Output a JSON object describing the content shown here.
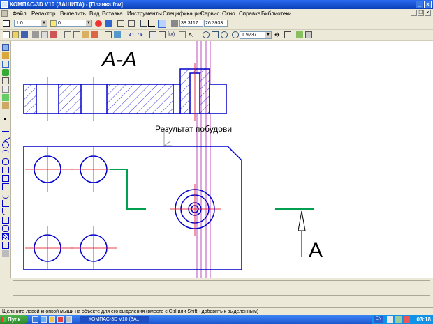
{
  "window": {
    "title": "КОМПАС-3D V10 (ЗАЩИТА) - [Планка.frw]"
  },
  "menu": [
    "Файл",
    "Редактор",
    "Выделить",
    "Вид",
    "Вставка",
    "Инструменты",
    "Спецификация",
    "Сервис",
    "Окно",
    "Справка",
    "Библиотеки"
  ],
  "toolbar": {
    "line_style": "1.0",
    "layer": "0",
    "coord_x": "38.3117",
    "coord_y": "26.3933",
    "zoom": "1.9237"
  },
  "drawing": {
    "section_label": "А-А",
    "view_label": "А",
    "annotation": "Результат побудови"
  },
  "status": {
    "hint": "Щелкните левой кнопкой мыши на объекте для его выделения (вместе с Ctrl или Shift - добавить к выделенным)"
  },
  "taskbar": {
    "start": "Пуск",
    "task": "КОМПАС-3D V10 (ЗА...",
    "lang": "EN",
    "clock": "03:18"
  },
  "colors": {
    "geometry": "#0000cc",
    "axis": "#e0001a",
    "leader": "#00a050",
    "guide": "#a000a0"
  }
}
